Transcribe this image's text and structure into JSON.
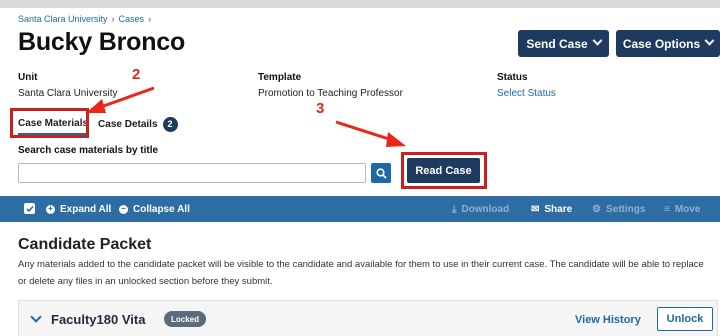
{
  "breadcrumb": [
    "Santa Clara University",
    "Cases"
  ],
  "page_title": "Bucky Bronco",
  "header_buttons": {
    "send_case": "Send Case",
    "case_options": "Case Options"
  },
  "meta": {
    "unit_label": "Unit",
    "unit_value": "Santa Clara University",
    "template_label": "Template",
    "template_value": "Promotion to Teaching Professor",
    "status_label": "Status",
    "status_value": "Select Status"
  },
  "annotations": {
    "two": "2",
    "three": "3",
    "color": "#e8261a"
  },
  "tabs": [
    {
      "label": "Case Materials",
      "active": true
    },
    {
      "label": "Case Details",
      "badge": "2",
      "active": false
    }
  ],
  "search": {
    "label": "Search case materials by title",
    "value": "",
    "placeholder": ""
  },
  "read_case": "Read Case",
  "toolbar": {
    "expand_all": "Expand All",
    "collapse_all": "Collapse All",
    "download": "Download",
    "share": "Share",
    "settings": "Settings",
    "move": "Move"
  },
  "section": {
    "title": "Candidate Packet",
    "description": "Any materials added to the candidate packet will be visible to the candidate and available for them to use in their current case. The candidate will be able to replace or delete any files in an unlocked section before they submit."
  },
  "row": {
    "title": "Faculty180 Vita",
    "badge": "Locked",
    "view_history": "View History",
    "unlock": "Unlock"
  },
  "colors": {
    "navy": "#1f3a5f",
    "link": "#1e6aa8",
    "toolbar": "#2e6da4",
    "highlight": "#c9211e"
  }
}
